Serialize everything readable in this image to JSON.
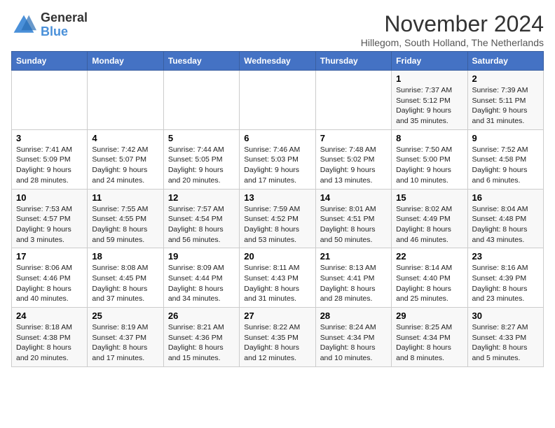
{
  "logo": {
    "line1": "General",
    "line2": "Blue"
  },
  "title": "November 2024",
  "location": "Hillegom, South Holland, The Netherlands",
  "days_of_week": [
    "Sunday",
    "Monday",
    "Tuesday",
    "Wednesday",
    "Thursday",
    "Friday",
    "Saturday"
  ],
  "weeks": [
    [
      {
        "day": "",
        "info": ""
      },
      {
        "day": "",
        "info": ""
      },
      {
        "day": "",
        "info": ""
      },
      {
        "day": "",
        "info": ""
      },
      {
        "day": "",
        "info": ""
      },
      {
        "day": "1",
        "info": "Sunrise: 7:37 AM\nSunset: 5:12 PM\nDaylight: 9 hours and 35 minutes."
      },
      {
        "day": "2",
        "info": "Sunrise: 7:39 AM\nSunset: 5:11 PM\nDaylight: 9 hours and 31 minutes."
      }
    ],
    [
      {
        "day": "3",
        "info": "Sunrise: 7:41 AM\nSunset: 5:09 PM\nDaylight: 9 hours and 28 minutes."
      },
      {
        "day": "4",
        "info": "Sunrise: 7:42 AM\nSunset: 5:07 PM\nDaylight: 9 hours and 24 minutes."
      },
      {
        "day": "5",
        "info": "Sunrise: 7:44 AM\nSunset: 5:05 PM\nDaylight: 9 hours and 20 minutes."
      },
      {
        "day": "6",
        "info": "Sunrise: 7:46 AM\nSunset: 5:03 PM\nDaylight: 9 hours and 17 minutes."
      },
      {
        "day": "7",
        "info": "Sunrise: 7:48 AM\nSunset: 5:02 PM\nDaylight: 9 hours and 13 minutes."
      },
      {
        "day": "8",
        "info": "Sunrise: 7:50 AM\nSunset: 5:00 PM\nDaylight: 9 hours and 10 minutes."
      },
      {
        "day": "9",
        "info": "Sunrise: 7:52 AM\nSunset: 4:58 PM\nDaylight: 9 hours and 6 minutes."
      }
    ],
    [
      {
        "day": "10",
        "info": "Sunrise: 7:53 AM\nSunset: 4:57 PM\nDaylight: 9 hours and 3 minutes."
      },
      {
        "day": "11",
        "info": "Sunrise: 7:55 AM\nSunset: 4:55 PM\nDaylight: 8 hours and 59 minutes."
      },
      {
        "day": "12",
        "info": "Sunrise: 7:57 AM\nSunset: 4:54 PM\nDaylight: 8 hours and 56 minutes."
      },
      {
        "day": "13",
        "info": "Sunrise: 7:59 AM\nSunset: 4:52 PM\nDaylight: 8 hours and 53 minutes."
      },
      {
        "day": "14",
        "info": "Sunrise: 8:01 AM\nSunset: 4:51 PM\nDaylight: 8 hours and 50 minutes."
      },
      {
        "day": "15",
        "info": "Sunrise: 8:02 AM\nSunset: 4:49 PM\nDaylight: 8 hours and 46 minutes."
      },
      {
        "day": "16",
        "info": "Sunrise: 8:04 AM\nSunset: 4:48 PM\nDaylight: 8 hours and 43 minutes."
      }
    ],
    [
      {
        "day": "17",
        "info": "Sunrise: 8:06 AM\nSunset: 4:46 PM\nDaylight: 8 hours and 40 minutes."
      },
      {
        "day": "18",
        "info": "Sunrise: 8:08 AM\nSunset: 4:45 PM\nDaylight: 8 hours and 37 minutes."
      },
      {
        "day": "19",
        "info": "Sunrise: 8:09 AM\nSunset: 4:44 PM\nDaylight: 8 hours and 34 minutes."
      },
      {
        "day": "20",
        "info": "Sunrise: 8:11 AM\nSunset: 4:43 PM\nDaylight: 8 hours and 31 minutes."
      },
      {
        "day": "21",
        "info": "Sunrise: 8:13 AM\nSunset: 4:41 PM\nDaylight: 8 hours and 28 minutes."
      },
      {
        "day": "22",
        "info": "Sunrise: 8:14 AM\nSunset: 4:40 PM\nDaylight: 8 hours and 25 minutes."
      },
      {
        "day": "23",
        "info": "Sunrise: 8:16 AM\nSunset: 4:39 PM\nDaylight: 8 hours and 23 minutes."
      }
    ],
    [
      {
        "day": "24",
        "info": "Sunrise: 8:18 AM\nSunset: 4:38 PM\nDaylight: 8 hours and 20 minutes."
      },
      {
        "day": "25",
        "info": "Sunrise: 8:19 AM\nSunset: 4:37 PM\nDaylight: 8 hours and 17 minutes."
      },
      {
        "day": "26",
        "info": "Sunrise: 8:21 AM\nSunset: 4:36 PM\nDaylight: 8 hours and 15 minutes."
      },
      {
        "day": "27",
        "info": "Sunrise: 8:22 AM\nSunset: 4:35 PM\nDaylight: 8 hours and 12 minutes."
      },
      {
        "day": "28",
        "info": "Sunrise: 8:24 AM\nSunset: 4:34 PM\nDaylight: 8 hours and 10 minutes."
      },
      {
        "day": "29",
        "info": "Sunrise: 8:25 AM\nSunset: 4:34 PM\nDaylight: 8 hours and 8 minutes."
      },
      {
        "day": "30",
        "info": "Sunrise: 8:27 AM\nSunset: 4:33 PM\nDaylight: 8 hours and 5 minutes."
      }
    ]
  ]
}
